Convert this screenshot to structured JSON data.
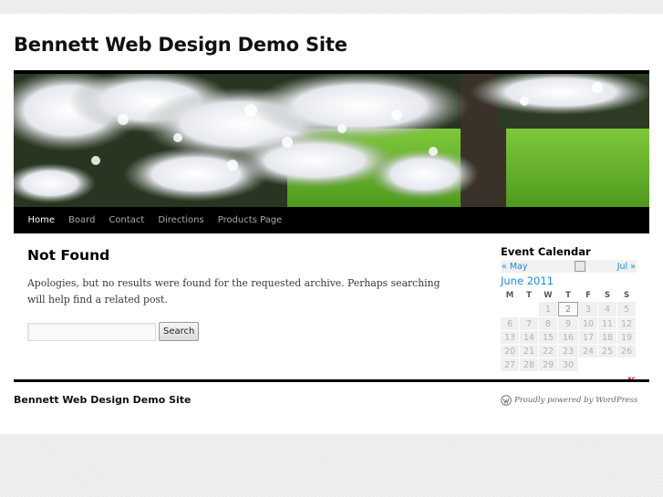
{
  "site": {
    "title": "Bennett Web Design Demo Site"
  },
  "nav": {
    "items": [
      {
        "label": "Home",
        "current": true
      },
      {
        "label": "Board",
        "current": false
      },
      {
        "label": "Contact",
        "current": false
      },
      {
        "label": "Directions",
        "current": false
      },
      {
        "label": "Products Page",
        "current": false
      }
    ]
  },
  "content": {
    "title": "Not Found",
    "message": "Apologies, but no results were found for the requested archive. Perhaps searching will help find a related post.",
    "search": {
      "placeholder": "",
      "value": "",
      "button_label": "Search"
    }
  },
  "calendar": {
    "widget_title": "Event Calendar",
    "prev_label": "« May",
    "next_label": "Jul »",
    "month_label": "June 2011",
    "weekdays": [
      "M",
      "T",
      "W",
      "T",
      "F",
      "S",
      "S"
    ],
    "weeks": [
      [
        "",
        "",
        "1",
        "2",
        "3",
        "4",
        "5"
      ],
      [
        "6",
        "7",
        "8",
        "9",
        "10",
        "11",
        "12"
      ],
      [
        "13",
        "14",
        "15",
        "16",
        "17",
        "18",
        "19"
      ],
      [
        "20",
        "21",
        "22",
        "23",
        "24",
        "25",
        "26"
      ],
      [
        "27",
        "28",
        "29",
        "30",
        "",
        "",
        ""
      ]
    ],
    "today": "2",
    "credit": "EC"
  },
  "footer": {
    "site_title": "Bennett Web Design Demo Site",
    "generator": "Proudly powered by WordPress"
  },
  "icons": {
    "rss": "rss-icon",
    "wordpress": "wordpress-logo-icon"
  },
  "colors": {
    "link": "#1b8be0",
    "nav_bg": "#000000"
  }
}
